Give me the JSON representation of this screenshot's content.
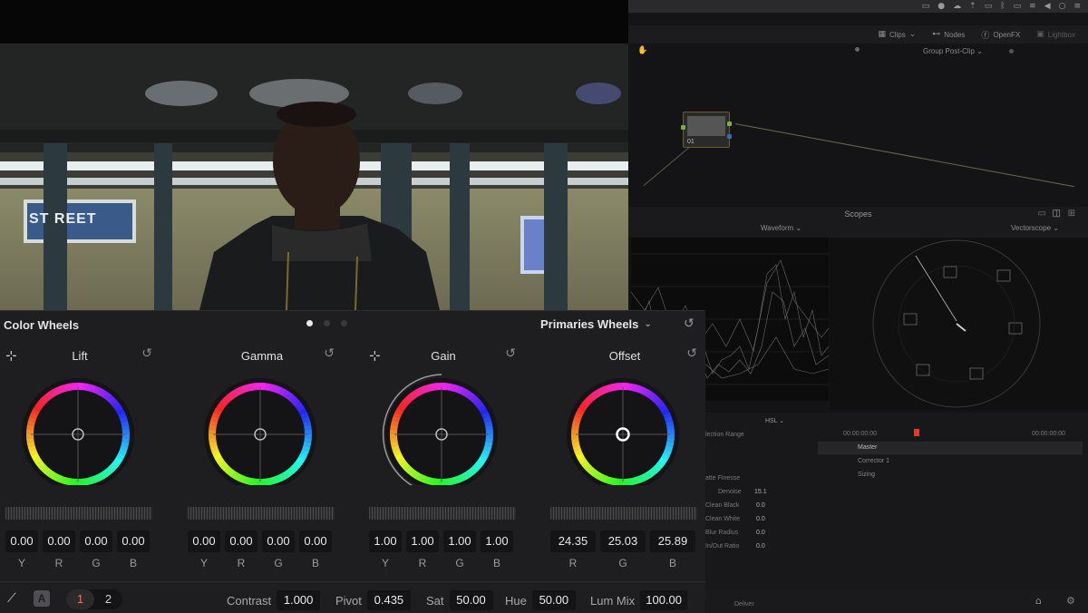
{
  "toolbar": {
    "clips": "Clips",
    "nodes": "Nodes",
    "openfx": "OpenFX",
    "lightbox": "Lightbox"
  },
  "node_editor": {
    "group_label": "Group Post-Clip",
    "node_label": "01"
  },
  "scopes": {
    "title": "Scopes",
    "left": "Waveform",
    "right": "Vectorscope"
  },
  "qualifier": {
    "hsl": "HSL",
    "selection_range": "lection Range",
    "matte_finesse": "atte Finesse",
    "timecode_a": "00:00:00:00",
    "timecode_b": "00:00:00:00",
    "rows": [
      {
        "label": "Denoise",
        "value": "15.1"
      },
      {
        "label": "Clean Black",
        "value": "0.0"
      },
      {
        "label": "Clean White",
        "value": "0.0"
      },
      {
        "label": "Blur Radius",
        "value": "0.0"
      },
      {
        "label": "In/Out Ratio",
        "value": "0.0"
      }
    ],
    "master": "Master",
    "layers": [
      "Corrector 1",
      "Sizing"
    ]
  },
  "deliver": "Deliver",
  "color_wheels": {
    "title": "Color Wheels",
    "mode": "Primaries Wheels",
    "wheels": [
      {
        "name": "Lift",
        "values": [
          "0.00",
          "0.00",
          "0.00",
          "0.00"
        ],
        "channels": [
          "Y",
          "R",
          "G",
          "B"
        ]
      },
      {
        "name": "Gamma",
        "values": [
          "0.00",
          "0.00",
          "0.00",
          "0.00"
        ],
        "channels": [
          "Y",
          "R",
          "G",
          "B"
        ]
      },
      {
        "name": "Gain",
        "values": [
          "1.00",
          "1.00",
          "1.00",
          "1.00"
        ],
        "channels": [
          "Y",
          "R",
          "G",
          "B"
        ]
      },
      {
        "name": "Offset",
        "values": [
          "24.35",
          "25.03",
          "25.89"
        ],
        "channels": [
          "R",
          "G",
          "B"
        ]
      }
    ],
    "bottom": {
      "auto_label": "A",
      "page_1": "1",
      "page_2": "2",
      "contrast_label": "Contrast",
      "contrast": "1.000",
      "pivot_label": "Pivot",
      "pivot": "0.435",
      "sat_label": "Sat",
      "sat": "50.00",
      "hue_label": "Hue",
      "hue": "50.00",
      "lummix_label": "Lum Mix",
      "lummix": "100.00"
    }
  },
  "viewer": {
    "sign_text": "ST REET"
  }
}
